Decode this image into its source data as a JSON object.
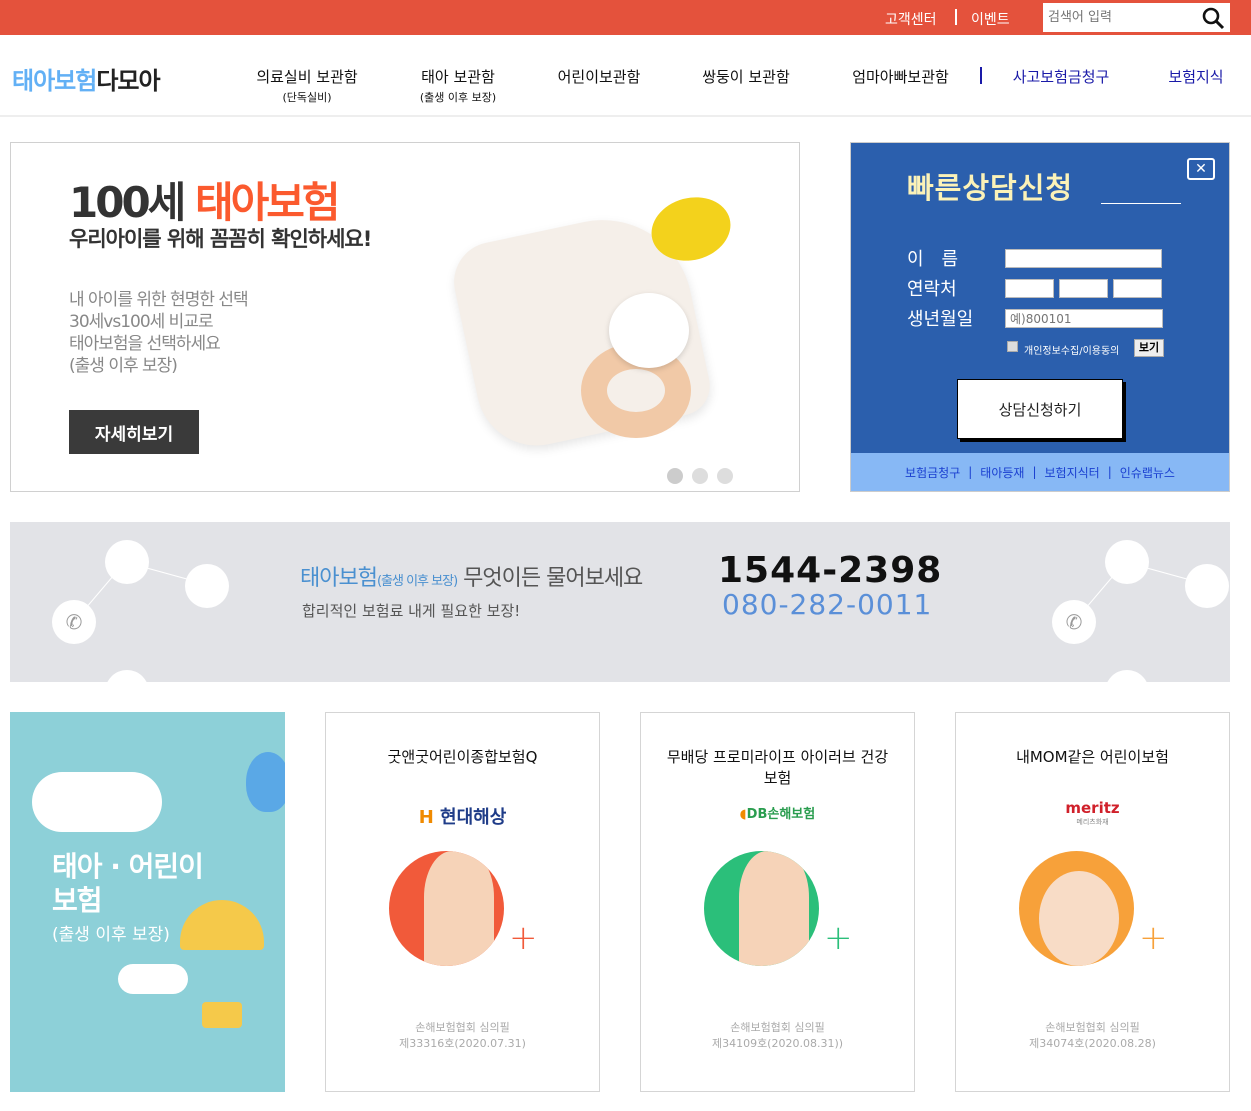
{
  "topbar": {
    "links": [
      "고객센터",
      "이벤트"
    ],
    "search_placeholder": "검색어 입력",
    "search_icon": "search-icon"
  },
  "header": {
    "logo_blue": "태아보험",
    "logo_dark": "다모아",
    "nav": [
      {
        "label": "의료실비 보관함",
        "sub": "(단독실비)"
      },
      {
        "label": "태아 보관함",
        "sub": "(출생 이후 보장)"
      },
      {
        "label": "어린이보관함"
      },
      {
        "label": "쌍둥이 보관함"
      },
      {
        "label": "엄마아빠보관함"
      },
      {
        "label": "사고보험금청구"
      },
      {
        "label": "보험지식"
      }
    ]
  },
  "banner": {
    "title_num": "100세",
    "title_brand": "태아보험",
    "subtitle": "우리아이를 위해 꼼꼼히 확인하세요!",
    "lines": [
      "내 아이를 위한 현명한 선택",
      "30세vs100세 비교로",
      "태아보험을 선택하세요",
      "(출생 이후 보장)"
    ],
    "button": "자세히보기",
    "slides": 3,
    "active_slide": 0
  },
  "consult": {
    "title": "빠른상담신청",
    "close_icon": "close-icon",
    "name_label": "이　름",
    "phone_label": "연락처",
    "birth_label": "생년월일",
    "birth_placeholder": "예)800101",
    "agree_label": "개인정보수집/이용동의",
    "view_button": "보기",
    "submit": "상담신청하기",
    "links": [
      "보험금청구",
      "태아등재",
      "보험지식터",
      "인슈랩뉴스"
    ]
  },
  "contact": {
    "brand": "태아보험",
    "brand_sub": "(출생 이후 보장)",
    "headline": "무엇이든 물어보세요",
    "sub": "합리적인 보험료 내게 필요한 보장!",
    "phone1": "1544-2398",
    "phone2": "080-282-0011"
  },
  "promo": {
    "title_lines": [
      "태아 · 어린이",
      "보험"
    ],
    "sub": "(출생 이후 보장)"
  },
  "products": [
    {
      "title": "굿앤굿어린이종합보험Q",
      "company": "현대해상",
      "approval": "손해보험협회 심의필",
      "number": "제33316호(2020.07.31)",
      "color": "#f15a3a"
    },
    {
      "title": "무배당 프로미라이프 아이러브 건강보험",
      "company": "DB손해보험",
      "approval": "손해보험협회 심의필",
      "number": "제34109호(2020.08.31))",
      "color": "#2bbf7a"
    },
    {
      "title": "내MOM같은 어린이보험",
      "company": "meritz",
      "company_sub": "메리츠화재",
      "approval": "손해보험협회 심의필",
      "number": "제34074호(2020.08.28)",
      "color": "#f7a13a"
    }
  ]
}
